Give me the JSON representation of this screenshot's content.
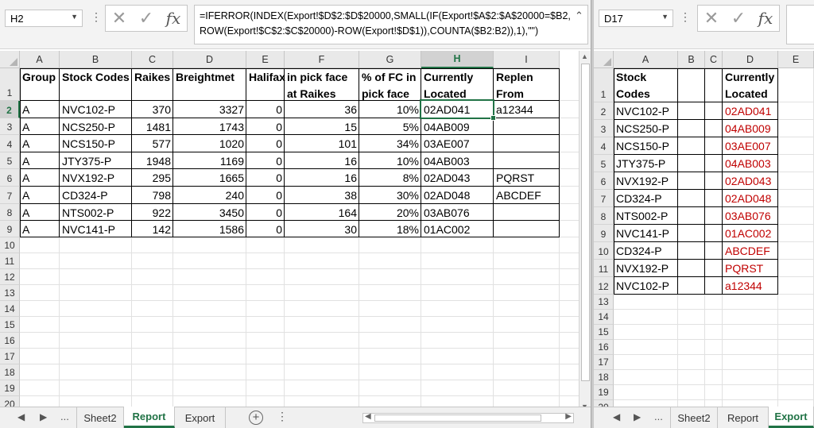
{
  "left": {
    "namebox": "H2",
    "formula": "=IFERROR(INDEX(Export!$D$2:$D$20000,SMALL(IF(Export!$A$2:$A$20000=$B2,\nROW(Export!$C$2:$C$20000)-ROW(Export!$D$1)),COUNTA($B2:B2)),1),\"\")",
    "columns": [
      "A",
      "B",
      "C",
      "D",
      "E",
      "F",
      "G",
      "H",
      "I"
    ],
    "row_numbers": [
      "1",
      "2",
      "3",
      "4",
      "5",
      "6",
      "7",
      "8",
      "9",
      "10",
      "11",
      "12",
      "13",
      "14",
      "15",
      "16",
      "17",
      "18",
      "19",
      "20"
    ],
    "headers": [
      "Group",
      "Stock Codes",
      "Raikes",
      "Breightmet",
      "Halifax",
      "in pick face at Raikes",
      "% of FC in pick face",
      "Currently Located",
      "Replen From"
    ],
    "rows": [
      [
        "A",
        "NVC102-P",
        "370",
        "3327",
        "0",
        "36",
        "10%",
        "02AD041",
        "a12344"
      ],
      [
        "A",
        "NCS250-P",
        "1481",
        "1743",
        "0",
        "15",
        "5%",
        "04AB009",
        ""
      ],
      [
        "A",
        "NCS150-P",
        "577",
        "1020",
        "0",
        "101",
        "34%",
        "03AE007",
        ""
      ],
      [
        "A",
        "JTY375-P",
        "1948",
        "1169",
        "0",
        "16",
        "10%",
        "04AB003",
        ""
      ],
      [
        "A",
        "NVX192-P",
        "295",
        "1665",
        "0",
        "16",
        "8%",
        "02AD043",
        "PQRST"
      ],
      [
        "A",
        "CD324-P",
        "798",
        "240",
        "0",
        "38",
        "30%",
        "02AD048",
        "ABCDEF"
      ],
      [
        "A",
        "NTS002-P",
        "922",
        "3450",
        "0",
        "164",
        "20%",
        "03AB076",
        ""
      ],
      [
        "A",
        "NVC141-P",
        "142",
        "1586",
        "0",
        "30",
        "18%",
        "01AC002",
        ""
      ]
    ],
    "tabs": {
      "more": "...",
      "sheet2": "Sheet2",
      "report": "Report",
      "export": "Export",
      "add": "+"
    }
  },
  "right": {
    "namebox": "D17",
    "columns": [
      "A",
      "B",
      "C",
      "D",
      "E"
    ],
    "row_numbers": [
      "1",
      "2",
      "3",
      "4",
      "5",
      "6",
      "7",
      "8",
      "9",
      "10",
      "11",
      "12",
      "13",
      "14",
      "15",
      "16",
      "17",
      "18",
      "19",
      "20"
    ],
    "headers": [
      "Stock Codes",
      "",
      "",
      "Currently Located"
    ],
    "rows": [
      [
        "NVC102-P",
        "02AD041"
      ],
      [
        "NCS250-P",
        "04AB009"
      ],
      [
        "NCS150-P",
        "03AE007"
      ],
      [
        "JTY375-P",
        "04AB003"
      ],
      [
        "NVX192-P",
        "02AD043"
      ],
      [
        "CD324-P",
        "02AD048"
      ],
      [
        "NTS002-P",
        "03AB076"
      ],
      [
        "NVC141-P",
        "01AC002"
      ],
      [
        "CD324-P",
        "ABCDEF"
      ],
      [
        "NVX192-P",
        "PQRST"
      ],
      [
        "NVC102-P",
        "a12344"
      ]
    ],
    "tabs": {
      "more": "...",
      "sheet2": "Sheet2",
      "report": "Report",
      "export": "Export"
    }
  },
  "colors": {
    "accent": "#217346",
    "red_text": "#c00000"
  }
}
